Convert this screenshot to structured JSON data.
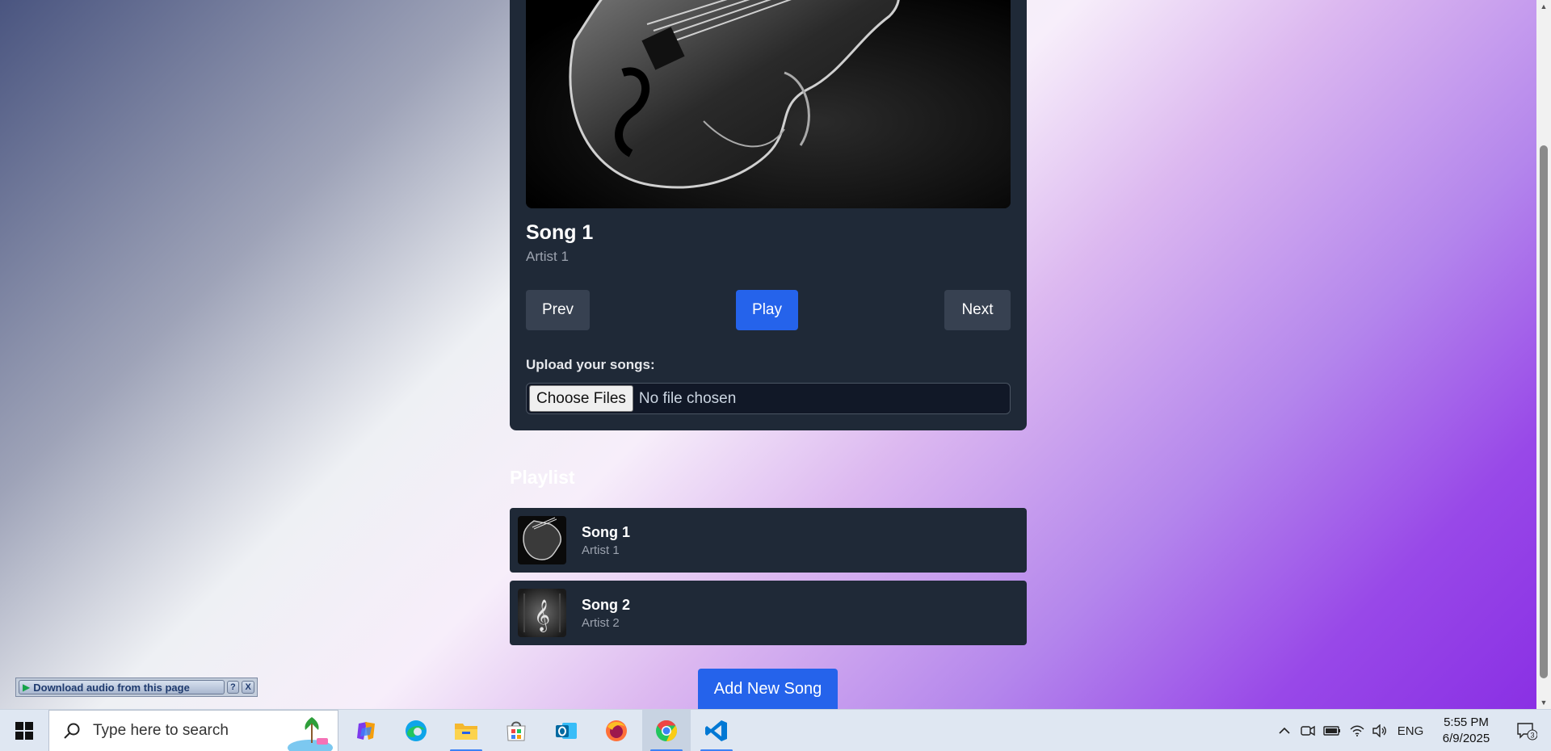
{
  "player": {
    "title": "Song 1",
    "artist": "Artist 1",
    "prev_label": "Prev",
    "play_label": "Play",
    "next_label": "Next",
    "upload_label": "Upload your songs:",
    "choose_files_label": "Choose Files",
    "file_status": "No file chosen"
  },
  "playlist": {
    "heading": "Playlist",
    "items": [
      {
        "title": "Song 1",
        "artist": "Artist 1",
        "thumb_icon": "violin-image"
      },
      {
        "title": "Song 2",
        "artist": "Artist 2",
        "thumb_icon": "treble-clef-image"
      }
    ]
  },
  "add_song_label": "Add New Song",
  "download_bar": {
    "label": "Download audio from this page",
    "help": "?",
    "close": "X"
  },
  "taskbar": {
    "search_placeholder": "Type here to search",
    "apps": [
      "copilot-icon",
      "edge-icon",
      "file-explorer-icon",
      "store-icon",
      "outlook-icon",
      "firefox-icon",
      "chrome-icon",
      "vscode-icon"
    ],
    "language": "ENG",
    "time": "5:55 PM",
    "date": "6/9/2025",
    "notification_count": "3"
  },
  "colors": {
    "card": "#1f2937",
    "accent": "#2563eb",
    "secondary_button": "#374151"
  }
}
